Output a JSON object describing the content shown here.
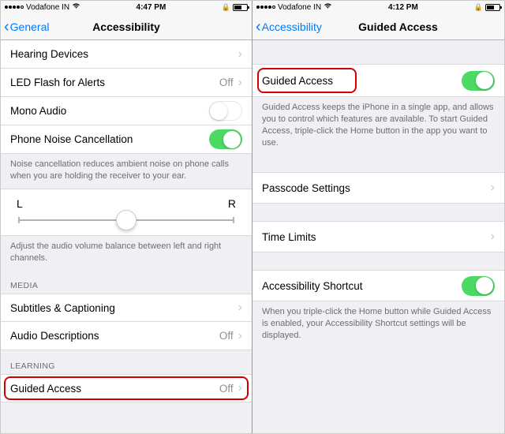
{
  "left": {
    "status": {
      "carrier": "Vodafone IN",
      "time": "4:47 PM",
      "battery_pct": 50
    },
    "nav": {
      "back": "General",
      "title": "Accessibility"
    },
    "rows": {
      "hearing": "Hearing Devices",
      "led_flash": "LED Flash for Alerts",
      "led_flash_value": "Off",
      "mono_audio": "Mono Audio",
      "noise_cancel": "Phone Noise Cancellation"
    },
    "noise_footer": "Noise cancellation reduces ambient noise on phone calls when you are holding the receiver to your ear.",
    "balance": {
      "left": "L",
      "right": "R"
    },
    "balance_footer": "Adjust the audio volume balance between left and right channels.",
    "media_header": "MEDIA",
    "subtitles": "Subtitles & Captioning",
    "audio_desc": "Audio Descriptions",
    "audio_desc_value": "Off",
    "learning_header": "LEARNING",
    "guided_access": "Guided Access",
    "guided_access_value": "Off"
  },
  "right": {
    "status": {
      "carrier": "Vodafone IN",
      "time": "4:12 PM",
      "battery_pct": 50
    },
    "nav": {
      "back": "Accessibility",
      "title": "Guided Access"
    },
    "ga_row": "Guided Access",
    "ga_footer": "Guided Access keeps the iPhone in a single app, and allows you to control which features are available. To start Guided Access, triple-click the Home button in the app you want to use.",
    "passcode": "Passcode Settings",
    "time_limits": "Time Limits",
    "shortcut": "Accessibility Shortcut",
    "shortcut_footer": "When you triple-click the Home button while Guided Access is enabled, your Accessibility Shortcut settings will be displayed."
  }
}
